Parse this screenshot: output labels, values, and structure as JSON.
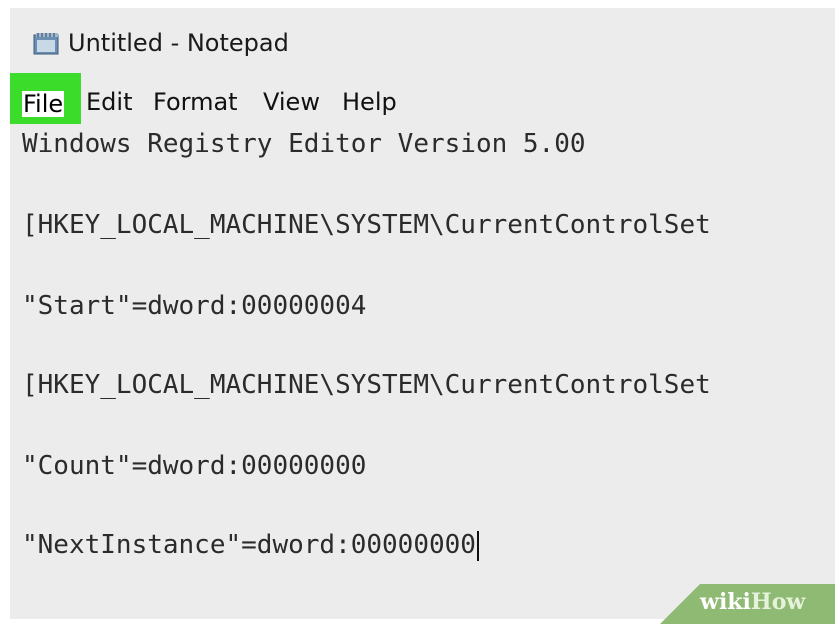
{
  "window": {
    "title": "Untitled - Notepad",
    "icon": "notepad-icon"
  },
  "menu": {
    "file": "File",
    "edit": "Edit",
    "format": "Format",
    "view": "View",
    "help": "Help",
    "highlight_color": "#3cdc2a"
  },
  "editor": {
    "lines": [
      "Windows Registry Editor Version 5.00",
      "[HKEY_LOCAL_MACHINE\\SYSTEM\\CurrentControlSet",
      "\"Start\"=dword:00000004",
      "[HKEY_LOCAL_MACHINE\\SYSTEM\\CurrentControlSet",
      "\"Count\"=dword:00000000",
      "\"NextInstance\"=dword:00000000"
    ]
  },
  "watermark": {
    "wiki": "wiki",
    "how": "How"
  }
}
